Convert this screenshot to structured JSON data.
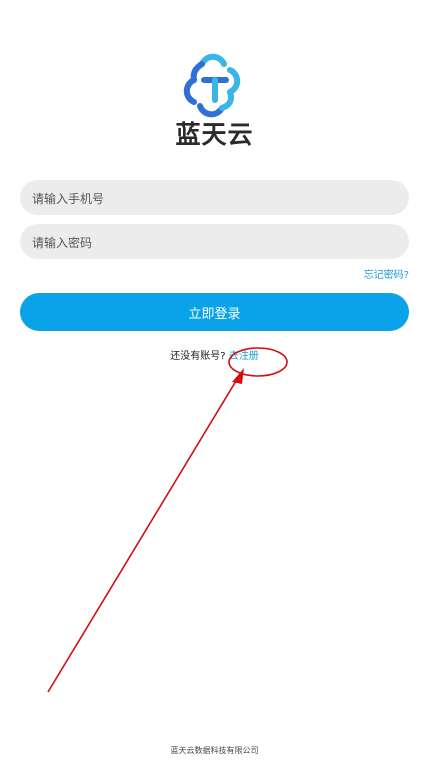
{
  "app": {
    "brand_name": "蓝天云"
  },
  "login_form": {
    "phone_placeholder": "请输入手机号",
    "phone_value": "",
    "password_placeholder": "请输入密码",
    "password_value": "",
    "forgot_password_label": "忘记密码?",
    "login_button_label": "立即登录"
  },
  "register": {
    "prompt": "还没有账号?",
    "link_label": "去注册"
  },
  "footer": {
    "company": "蓝天云数据科技有限公司"
  },
  "colors": {
    "primary": "#0aa3ea",
    "link": "#1a9ad8",
    "input_bg": "#ececec",
    "annotation": "#d01010",
    "logo_dark": "#2f6fd6",
    "logo_light": "#38b6e8"
  },
  "icons": {
    "logo": "cloud-t-logo-icon"
  }
}
